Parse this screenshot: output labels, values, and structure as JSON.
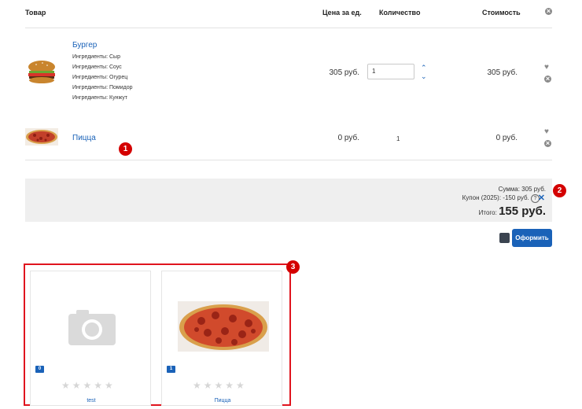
{
  "table": {
    "headers": {
      "product": "Товар",
      "unit_price": "Цена за ед.",
      "quantity": "Количество",
      "cost": "Стоимость"
    }
  },
  "items": [
    {
      "name": "Бургер",
      "ingredients": [
        {
          "label": "Ингредиенты:",
          "value": "Сыр"
        },
        {
          "label": "Ингредиенты:",
          "value": "Соус"
        },
        {
          "label": "Ингредиенты:",
          "value": "Огурец"
        },
        {
          "label": "Ингредиенты:",
          "value": "Помидор"
        },
        {
          "label": "Ингредиенты:",
          "value": "Кунжут"
        }
      ],
      "unit_price": "305 руб.",
      "quantity": "1",
      "cost": "305 руб."
    },
    {
      "name": "Пицца",
      "unit_price": "0 руб.",
      "quantity": "1",
      "cost": "0 руб."
    }
  ],
  "summary": {
    "sum": "Сумма: 305 руб.",
    "coupon": "Купон (2025): -150 руб.",
    "total_label": "Итого:",
    "total_value": "155 руб."
  },
  "checkout_label": "Оформить",
  "annotations": [
    "1",
    "2",
    "3"
  ],
  "related": [
    {
      "name": "test",
      "count": "0",
      "icon": "camera-placeholder-icon",
      "rating": 0
    },
    {
      "name": "Пицца",
      "count": "1",
      "icon": "pizza-image",
      "rating": 0
    }
  ],
  "colors": {
    "accent": "#1a62b8",
    "annotation": "#d40000",
    "totals_bg": "#efefef"
  }
}
